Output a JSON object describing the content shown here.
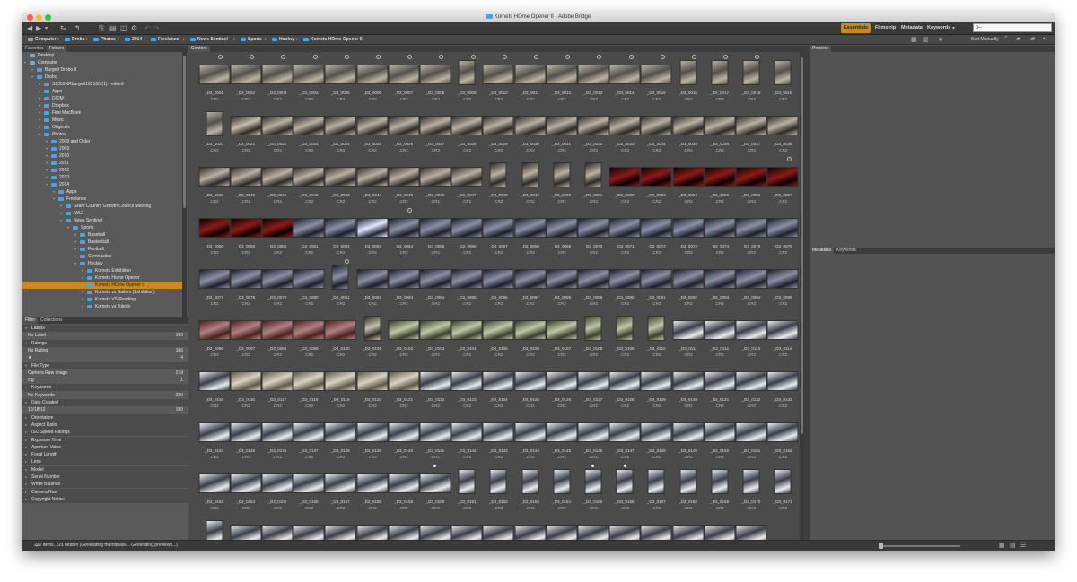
{
  "window": {
    "title": "Komets HOme Opener II - Adobe Bridge"
  },
  "workspaces": [
    "Essentials",
    "Filmstrip",
    "Metadata",
    "Keywords"
  ],
  "search": {
    "placeholder": "ρ–"
  },
  "breadcrumb": [
    "Computer",
    "Drobo",
    "Photos",
    "2014",
    "Freelance",
    "News Sentinel",
    "Sports",
    "Hockey",
    "Komets HOme Opener II"
  ],
  "sort_label": "Sort Manually",
  "panels": {
    "left_tabs": [
      "Favorites",
      "Folders"
    ],
    "content_tab": "Content",
    "preview_tab": "Preview",
    "meta_tabs": [
      "Metadata",
      "Keywords"
    ],
    "filter_tabs": [
      "Filter",
      "Collections"
    ]
  },
  "folders": [
    {
      "label": "Desktop",
      "level": 0
    },
    {
      "label": "Computer",
      "level": 0
    },
    {
      "label": "Burgett Drobo II",
      "level": 1
    },
    {
      "label": "Drobo",
      "level": 1
    },
    {
      "label": "S1355NRburgett102105 (1) - edited",
      "level": 2
    },
    {
      "label": "Apps",
      "level": 2
    },
    {
      "label": "DCIM",
      "level": 2
    },
    {
      "label": "Dropbox",
      "level": 2
    },
    {
      "label": "First MacBook",
      "level": 2
    },
    {
      "label": "Music",
      "level": 2
    },
    {
      "label": "Originals",
      "level": 2
    },
    {
      "label": "Photos",
      "level": 2
    },
    {
      "label": "2008 and Older",
      "level": 3
    },
    {
      "label": "2009",
      "level": 3
    },
    {
      "label": "2010",
      "level": 3
    },
    {
      "label": "2011",
      "level": 3
    },
    {
      "label": "2012",
      "level": 3
    },
    {
      "label": "2013",
      "level": 3
    },
    {
      "label": "2014",
      "level": 3
    },
    {
      "label": "Apps",
      "level": 4
    },
    {
      "label": "Freelance",
      "level": 4
    },
    {
      "label": "Grant Country Growth Council Meeting",
      "level": 5
    },
    {
      "label": "IWU",
      "level": 5
    },
    {
      "label": "News Sentinel",
      "level": 5
    },
    {
      "label": "Sports",
      "level": 6
    },
    {
      "label": "Baseball",
      "level": 7
    },
    {
      "label": "Basketball",
      "level": 7
    },
    {
      "label": "Football",
      "level": 7
    },
    {
      "label": "Gymnastics",
      "level": 7
    },
    {
      "label": "Hockey",
      "level": 7
    },
    {
      "label": "Komets Exhibition",
      "level": 8
    },
    {
      "label": "Komets Home Opener",
      "level": 8
    },
    {
      "label": "Komets HOme Opener II",
      "level": 8,
      "selected": true
    },
    {
      "label": "Komets vs Nailers (Exhibition)",
      "level": 8
    },
    {
      "label": "Komets VS Reading",
      "level": 8
    },
    {
      "label": "Komets vs Toledo",
      "level": 8
    }
  ],
  "filters": [
    {
      "label": "Labels",
      "head": true
    },
    {
      "label": "No Label",
      "count": "190"
    },
    {
      "label": "Ratings",
      "head": true
    },
    {
      "label": "No Rating",
      "count": "186"
    },
    {
      "label": "★",
      "count": "4"
    },
    {
      "label": "File Type",
      "head": true
    },
    {
      "label": "Camera Raw image",
      "count": "219"
    },
    {
      "label": "ctg",
      "count": "1"
    },
    {
      "label": "Keywords",
      "head": true
    },
    {
      "label": "No Keywords",
      "count": "220"
    },
    {
      "label": "Date Created",
      "head": true
    },
    {
      "label": "10/18/13",
      "count": "190"
    },
    {
      "label": "Orientation",
      "head": true
    },
    {
      "label": "Aspect Ratio",
      "head": true
    },
    {
      "label": "ISO Speed Ratings",
      "head": true
    },
    {
      "label": "Exposure Time",
      "head": true
    },
    {
      "label": "Aperture Value",
      "head": true
    },
    {
      "label": "Focal Length",
      "head": true
    },
    {
      "label": "Lens",
      "head": true
    },
    {
      "label": "Model",
      "head": true
    },
    {
      "label": "Serial Number",
      "head": true
    },
    {
      "label": "White Balance",
      "head": true
    },
    {
      "label": "Camera Raw",
      "head": true
    },
    {
      "label": "Copyright Notice",
      "head": true
    }
  ],
  "thumbnails": {
    "prefix": "_D3_",
    "start": 1,
    "count": 189,
    "ext": ".CR2",
    "columns": 19,
    "types": {
      "1": "h-arena",
      "2": "h-arena",
      "3": "h-arena",
      "4": "h-arena",
      "5": "h-arena",
      "6": "h-arena",
      "7": "h-arena",
      "8": "h-arena",
      "9": "v-arena",
      "10": "h-arena",
      "11": "h-arena",
      "12": "h-arena",
      "13": "h-arena",
      "14": "h-arena",
      "15": "h-arena",
      "16": "v-arena",
      "17": "v-arena",
      "18": "v-arena",
      "19": "v-arena",
      "20": "v-arena",
      "21": "h-dark",
      "22": "h-podium",
      "23": "h-podium",
      "24": "h-podium",
      "25": "h-podium",
      "26": "h-podium",
      "27": "h-podium",
      "28": "h-podium",
      "29": "h-podium",
      "30": "h-podium",
      "31": "h-podium",
      "32": "h-podium",
      "33": "h-podium",
      "34": "h-podium",
      "35": "h-podium",
      "36": "h-podium",
      "37": "h-podium",
      "38": "h-podium",
      "39": "h-podium",
      "40": "h-podium",
      "41": "h-podium",
      "42": "h-podium",
      "43": "h-podium",
      "44": "h-podium",
      "45": "h-podium",
      "46": "h-podium",
      "47": "h-podium",
      "48": "v-podium",
      "49": "v-podium",
      "50": "v-podium",
      "51": "v-podium",
      "52": "h-red",
      "53": "h-red",
      "54": "h-red",
      "55": "h-red",
      "56": "h-red",
      "57": "h-red",
      "58": "h-red",
      "59": "h-red",
      "60": "h-red",
      "61": "h-crowd",
      "62": "h-crowd",
      "63": "h-bright",
      "64": "h-crowd",
      "65": "h-crowd",
      "66": "h-crowd",
      "67": "h-crowd",
      "68": "h-crowd",
      "69": "h-crowd",
      "70": "h-crowd",
      "71": "h-crowd",
      "72": "h-crowd",
      "73": "h-crowd",
      "74": "h-crowd",
      "75": "h-crowd",
      "76": "h-crowd",
      "77": "h-crowd",
      "78": "h-crowd",
      "79": "h-crowd",
      "80": "h-crowd",
      "81": "v-crowd",
      "82": "h-crowd",
      "83": "h-crowd",
      "84": "h-crowd",
      "85": "h-crowd",
      "86": "h-crowd",
      "87": "h-crowd",
      "88": "h-crowd",
      "89": "h-crowd",
      "90": "h-crowd",
      "91": "h-crowd",
      "92": "h-crowd",
      "93": "h-crowd",
      "94": "h-crowd",
      "95": "h-crowd",
      "96": "h-maroon",
      "97": "h-maroon",
      "98": "h-maroon",
      "99": "h-maroon",
      "100": "h-maroon",
      "101": "v-dark",
      "102": "h-green",
      "103": "h-green",
      "104": "h-green",
      "105": "h-green",
      "106": "h-green",
      "107": "h-green",
      "108": "v-green",
      "109": "v-green",
      "110": "v-green",
      "111": "h-ice",
      "112": "h-ice",
      "113": "h-ice",
      "114": "h-ice",
      "115": "h-ice",
      "116": "h-suit",
      "117": "h-suit",
      "118": "h-suit",
      "119": "h-suit",
      "120": "h-suit",
      "121": "h-suit",
      "122": "h-ice",
      "123": "h-ice",
      "124": "h-ice",
      "125": "h-ice",
      "126": "h-ice",
      "127": "h-ice",
      "128": "h-ice",
      "129": "h-ice",
      "130": "h-ice",
      "131": "h-ice",
      "132": "h-ice",
      "133": "h-ice"
    },
    "default_type": "h-ice",
    "vertical_after": 160,
    "vertical_type": "v-ice",
    "badged": [
      1,
      2,
      3,
      4,
      5,
      6,
      7,
      8,
      9,
      10,
      11,
      12,
      13,
      14,
      15,
      16,
      17,
      18,
      57,
      64,
      81
    ],
    "rated": [
      160,
      165,
      166
    ]
  },
  "status": {
    "text": "220 items, 221 hidden (Generating thumbnails... Generating previews...)"
  },
  "colors": {
    "accent": "#c88b1a",
    "folder": "#4aa3e3",
    "panel": "#535353"
  }
}
